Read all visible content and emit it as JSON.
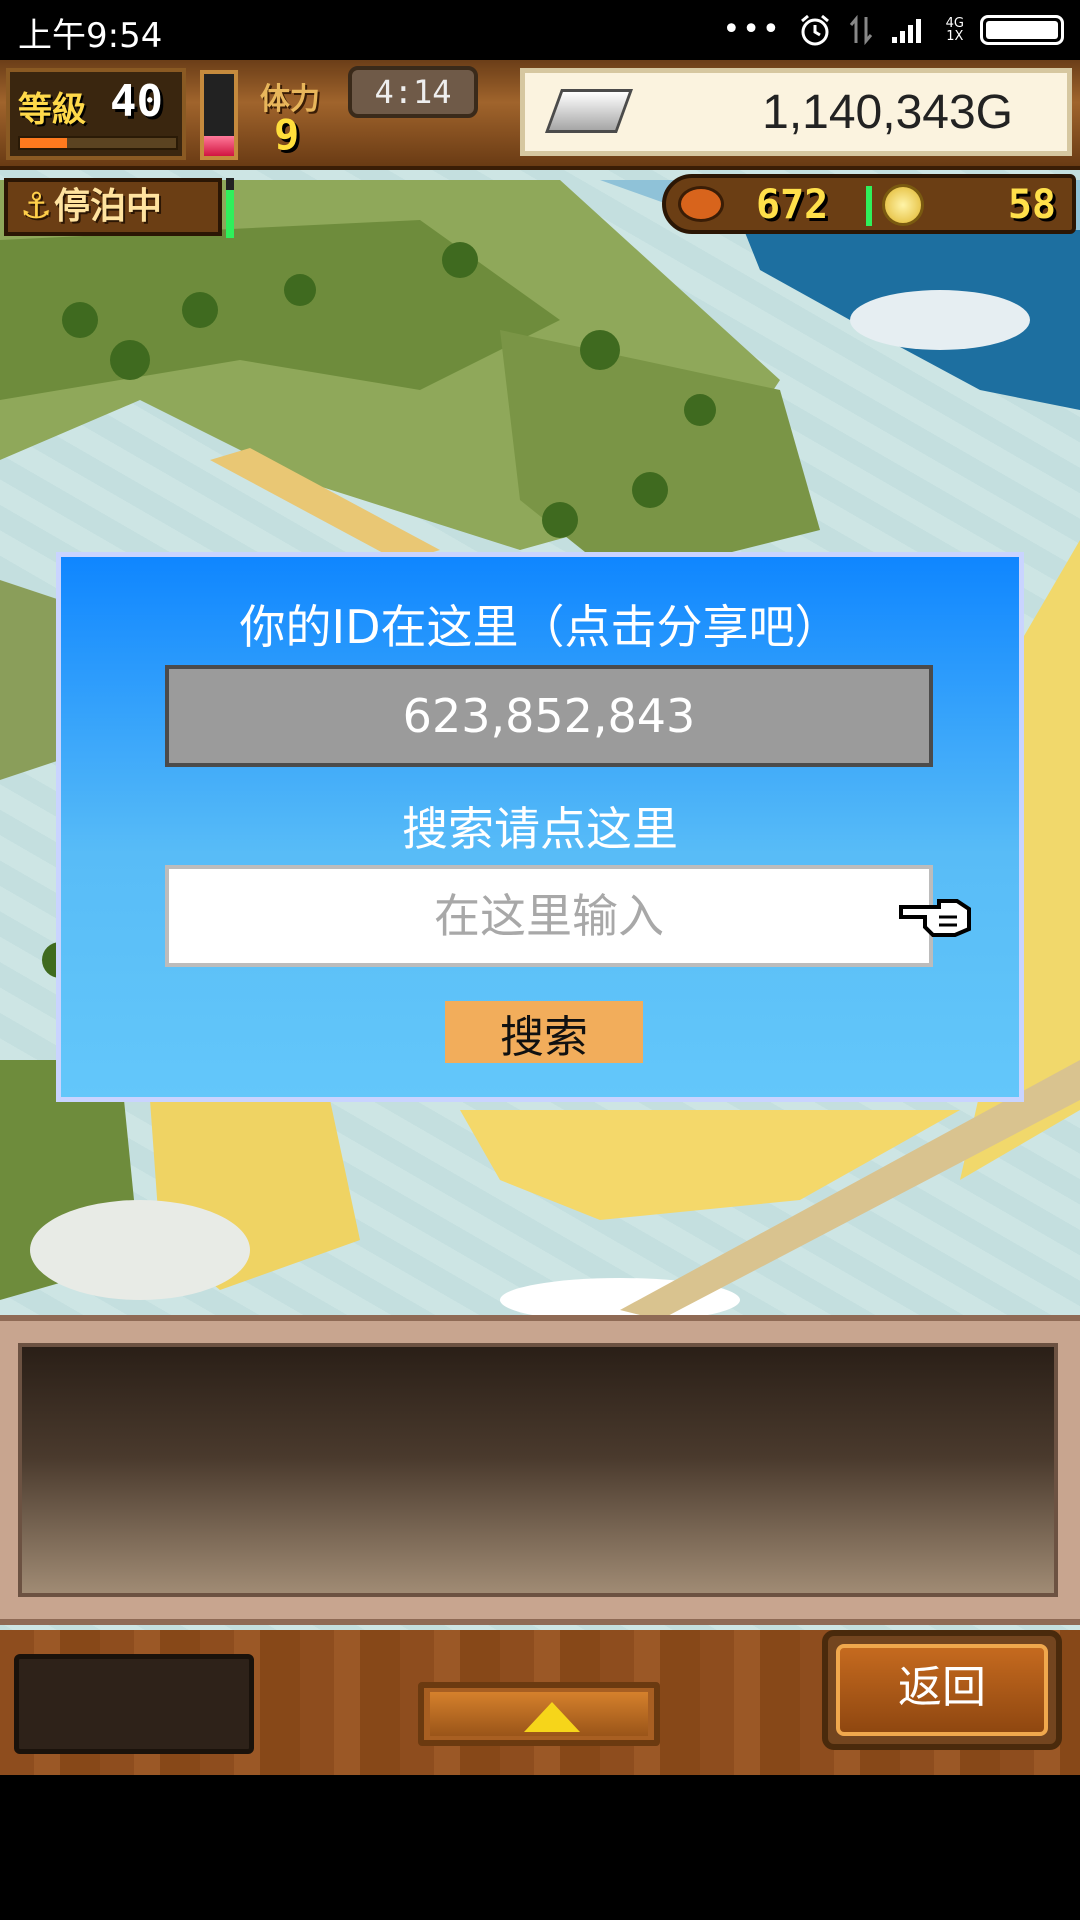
{
  "status_bar": {
    "time": "上午9:54",
    "dots": "•••",
    "network_top": "4G",
    "network_bottom": "1X",
    "battery_level": 1.0
  },
  "hud": {
    "level_label": "等級",
    "level_value": "40",
    "level_progress": 0.3,
    "stamina_label": "体力",
    "stamina_value": "9",
    "stamina_fill": 0.25,
    "timer": "4:14",
    "gold": "1,140,343G"
  },
  "status": {
    "mooring": "停泊中",
    "mooring_icon": "anchor-icon",
    "mooring_gauge": 0.8
  },
  "resources": {
    "food": "672",
    "coins": "58"
  },
  "dialog": {
    "id_heading": "你的ID在这里（点击分享吧）",
    "id_value": "623,852,843",
    "search_heading": "搜索请点这里",
    "search_placeholder": "在这里输入",
    "search_value": "",
    "search_button": "搜索"
  },
  "bottom": {
    "back_button": "返回"
  },
  "colors": {
    "dialog_top": "#0f86ff",
    "dialog_bottom": "#63c7fa",
    "search_button_bg": "#f2ad5b",
    "id_field_bg": "#9b9b9b"
  }
}
